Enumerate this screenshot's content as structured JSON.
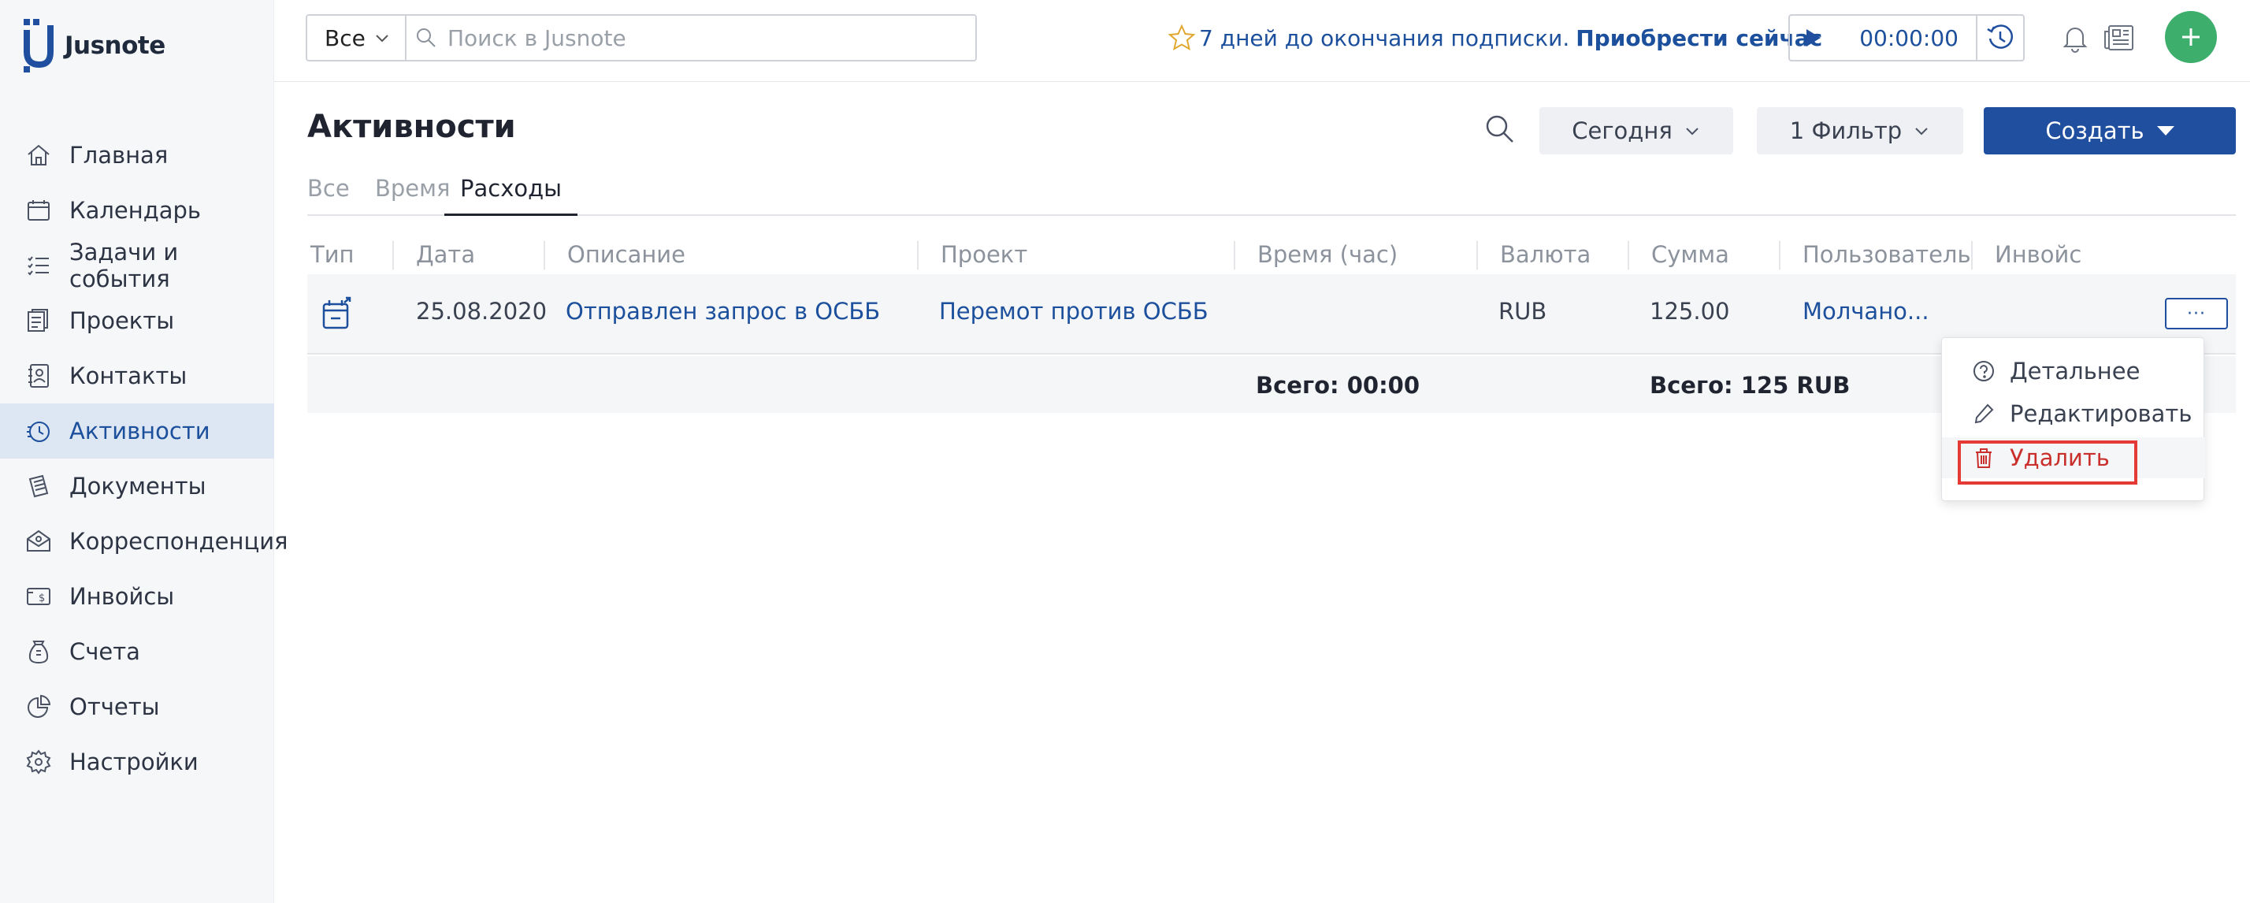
{
  "app": {
    "name": "Jusnote"
  },
  "sidebar": {
    "items": [
      {
        "label": "Главная",
        "icon": "home-icon"
      },
      {
        "label": "Календарь",
        "icon": "calendar-icon"
      },
      {
        "label": "Задачи и события",
        "icon": "tasks-icon"
      },
      {
        "label": "Проекты",
        "icon": "projects-icon"
      },
      {
        "label": "Контакты",
        "icon": "contacts-icon"
      },
      {
        "label": "Активности",
        "icon": "activities-icon",
        "active": true
      },
      {
        "label": "Документы",
        "icon": "documents-icon"
      },
      {
        "label": "Корреспонденция",
        "icon": "correspondence-icon"
      },
      {
        "label": "Инвойсы",
        "icon": "invoices-icon"
      },
      {
        "label": "Счета",
        "icon": "accounts-icon"
      },
      {
        "label": "Отчеты",
        "icon": "reports-icon"
      },
      {
        "label": "Настройки",
        "icon": "settings-icon"
      }
    ]
  },
  "topbar": {
    "scope_label": "Все",
    "search_placeholder": "Поиск в Jusnote",
    "promo_text": "7 дней до окончания подписки.",
    "promo_link": "Приобрести сейчас",
    "timer_value": "00:00:00"
  },
  "header": {
    "title": "Активности",
    "date_filter": "Сегодня",
    "filter_label": "1 Фильтр",
    "create_label": "Создать"
  },
  "tabs": [
    {
      "label": "Все",
      "active": false
    },
    {
      "label": "Время",
      "active": false
    },
    {
      "label": "Расходы",
      "active": true
    }
  ],
  "table": {
    "columns": [
      "Тип",
      "Дата",
      "Описание",
      "Проект",
      "Время (час)",
      "Валюта",
      "Сумма",
      "Пользователь",
      "Инвойс"
    ],
    "rows": [
      {
        "type_icon": "expense-icon",
        "date": "25.08.2020",
        "description": "Отправлен запрос в ОСББ",
        "project": "Перемот против ОСББ",
        "hours": "",
        "currency": "RUB",
        "amount": "125.00",
        "user": "Молчано...",
        "invoice": "",
        "menu_label": "···"
      }
    ],
    "totals": {
      "time": "Всего: 00:00",
      "amount": "Всего: 125 RUB"
    }
  },
  "row_menu": {
    "items": [
      {
        "label": "Детальнее",
        "icon": "help-circle-icon"
      },
      {
        "label": "Редактировать",
        "icon": "pencil-icon"
      },
      {
        "label": "Удалить",
        "icon": "trash-icon",
        "color": "#c9302c"
      }
    ]
  },
  "colors": {
    "accent": "#1f4f9e",
    "link": "#1c4f9c",
    "add_button": "#3dae6c",
    "danger": "#c9302c",
    "highlight": "#e53935"
  }
}
